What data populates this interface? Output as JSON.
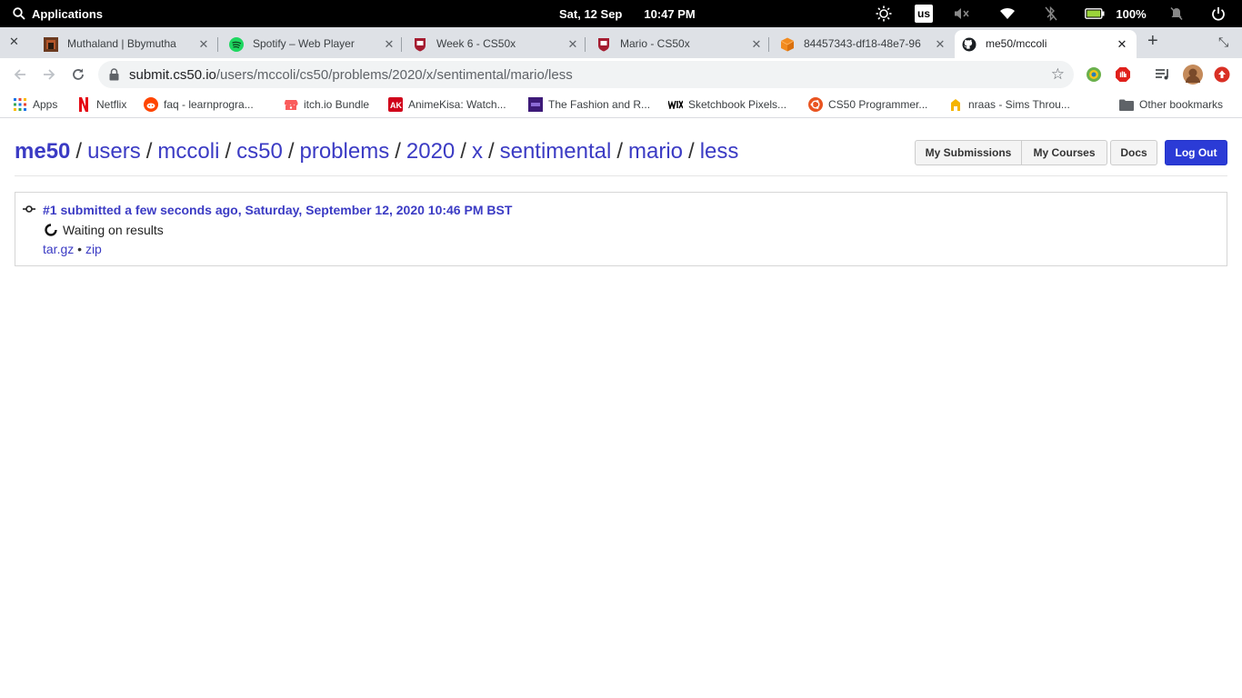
{
  "topbar": {
    "applications_label": "Applications",
    "date": "Sat, 12 Sep",
    "time": "10:47 PM",
    "keyboard_layout": "us",
    "battery": "100%"
  },
  "tabs": [
    {
      "title": "Muthaland | Bbymutha",
      "active": false
    },
    {
      "title": "Spotify – Web Player",
      "active": false
    },
    {
      "title": "Week 6 - CS50x",
      "active": false
    },
    {
      "title": "Mario - CS50x",
      "active": false
    },
    {
      "title": "84457343-df18-48e7-96",
      "active": false
    },
    {
      "title": "me50/mccoli",
      "active": true
    }
  ],
  "address_bar": {
    "host": "submit.cs50.io",
    "path": "/users/mccoli/cs50/problems/2020/x/sentimental/mario/less"
  },
  "bookmarks": [
    {
      "label": "Apps"
    },
    {
      "label": "Netflix"
    },
    {
      "label": "faq - learnprogra..."
    },
    {
      "label": "itch.io Bundle"
    },
    {
      "label": "AnimeKisa: Watch..."
    },
    {
      "label": "The Fashion and R..."
    },
    {
      "label": "Sketchbook Pixels..."
    },
    {
      "label": "CS50 Programmer..."
    },
    {
      "label": "nraas - Sims Throu..."
    },
    {
      "label": "Other bookmarks"
    }
  ],
  "breadcrumb": {
    "brand": "me50",
    "items": [
      "users",
      "mccoli",
      "cs50",
      "problems",
      "2020",
      "x",
      "sentimental",
      "mario",
      "less"
    ],
    "separator": "/"
  },
  "header_buttons": {
    "my_submissions": "My Submissions",
    "my_courses": "My Courses",
    "docs": "Docs",
    "log_out": "Log Out"
  },
  "submission": {
    "title": "#1 submitted a few seconds ago, Saturday, September 12, 2020 10:46 PM BST",
    "status": "Waiting on results",
    "download_targz": "tar.gz",
    "separator": "•",
    "download_zip": "zip"
  },
  "colors": {
    "link": "#3b3bc4",
    "primary_button": "#2b3bd6",
    "tab_strip": "#dee1e6"
  }
}
